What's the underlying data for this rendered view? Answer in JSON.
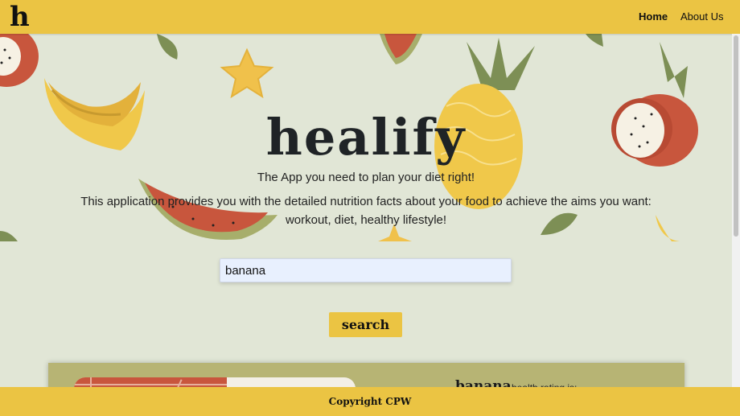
{
  "nav": {
    "logo": "h",
    "links": [
      {
        "label": "Home",
        "active": true
      },
      {
        "label": "About Us",
        "active": false
      }
    ]
  },
  "hero": {
    "title": "healify",
    "tagline": "The App you need to plan your diet right!",
    "description": "This application provides you with the detailed nutrition facts about your food to achieve the aims you want: workout, diet, healthy lifestyle!"
  },
  "search": {
    "value": "banana",
    "button_label": "search"
  },
  "result": {
    "food_name": "banana",
    "rating_label": "health rating is:"
  },
  "footer": {
    "text": "Copyright CPW"
  },
  "colors": {
    "accent": "#ebc443",
    "background": "#e1e6d6",
    "card": "#b7b474"
  }
}
